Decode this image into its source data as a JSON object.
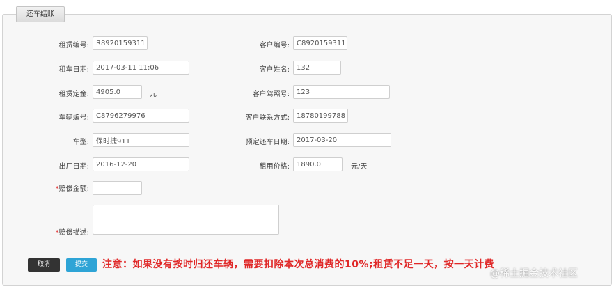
{
  "panel": {
    "title": "还车结账"
  },
  "form": {
    "rental_no": {
      "label": "租赁编号:",
      "value": "R8920159311"
    },
    "customer_no": {
      "label": "客户编号:",
      "value": "C8920159311"
    },
    "rent_date": {
      "label": "租车日期:",
      "value": "2017-03-11 11:06"
    },
    "customer_name": {
      "label": "客户姓名:",
      "value": "132"
    },
    "deposit": {
      "label": "租赁定金:",
      "value": "4905.0",
      "unit": "元"
    },
    "id_card": {
      "label": "客户驾照号:",
      "value": "123"
    },
    "vehicle_no": {
      "label": "车辆编号:",
      "value": "C8796279976"
    },
    "contact": {
      "label": "客户联系方式:",
      "value": "18780199788"
    },
    "model": {
      "label": "车型:",
      "value": "保时捷911"
    },
    "due_date": {
      "label": "预定还车日期:",
      "value": "2017-03-20"
    },
    "factory_date": {
      "label": "出厂日期:",
      "value": "2016-12-20"
    },
    "price": {
      "label": "租用价格:",
      "value": "1890.0",
      "unit": "元/天"
    },
    "compensation": {
      "required_mark": "*",
      "label": "赔偿金额:",
      "value": ""
    },
    "damage_desc": {
      "required_mark": "*",
      "label": "赔偿描述:",
      "value": ""
    }
  },
  "actions": {
    "cancel_label": "取消",
    "submit_label": "提交"
  },
  "notice": "注意：如果没有按时归还车辆，需要扣除本次总消费的10%;租赁不足一天，按一天计费",
  "watermark": "@稀土掘金技术社区"
}
